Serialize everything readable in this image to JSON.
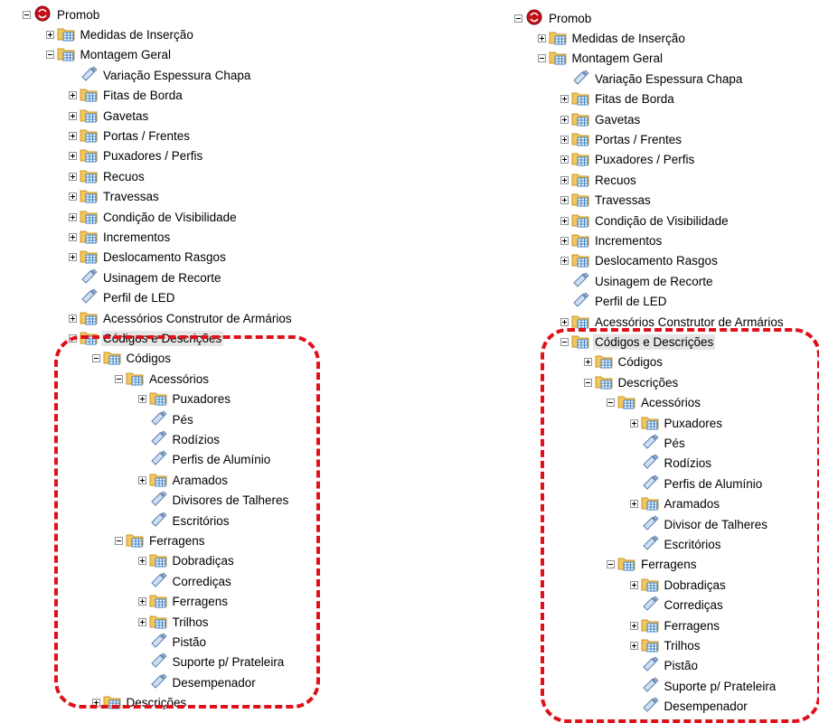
{
  "highlight_color": "#e0101a",
  "icons": {
    "root": "promob-logo-icon",
    "folder": "folder-table-icon",
    "leaf": "tag-pencil-icon"
  },
  "left_tree": {
    "items": [
      {
        "label": "Promob",
        "icon": "root",
        "exp": "minus",
        "depth": 0
      },
      {
        "label": "Medidas de Inserção",
        "icon": "folder",
        "exp": "plus",
        "depth": 1
      },
      {
        "label": "Montagem Geral",
        "icon": "folder",
        "exp": "minus",
        "depth": 1
      },
      {
        "label": "Variação Espessura Chapa",
        "icon": "leaf",
        "exp": "none",
        "depth": 2
      },
      {
        "label": "Fitas de Borda",
        "icon": "folder",
        "exp": "plus",
        "depth": 2
      },
      {
        "label": "Gavetas",
        "icon": "folder",
        "exp": "plus",
        "depth": 2
      },
      {
        "label": "Portas / Frentes",
        "icon": "folder",
        "exp": "plus",
        "depth": 2
      },
      {
        "label": "Puxadores / Perfis",
        "icon": "folder",
        "exp": "plus",
        "depth": 2
      },
      {
        "label": "Recuos",
        "icon": "folder",
        "exp": "plus",
        "depth": 2
      },
      {
        "label": "Travessas",
        "icon": "folder",
        "exp": "plus",
        "depth": 2
      },
      {
        "label": "Condição de Visibilidade",
        "icon": "folder",
        "exp": "plus",
        "depth": 2
      },
      {
        "label": "Incrementos",
        "icon": "folder",
        "exp": "plus",
        "depth": 2
      },
      {
        "label": "Deslocamento Rasgos",
        "icon": "folder",
        "exp": "plus",
        "depth": 2
      },
      {
        "label": "Usinagem de Recorte",
        "icon": "leaf",
        "exp": "none",
        "depth": 2
      },
      {
        "label": "Perfil de LED",
        "icon": "leaf",
        "exp": "none",
        "depth": 2
      },
      {
        "label": "Acessórios Construtor de Armários",
        "icon": "folder",
        "exp": "plus",
        "depth": 2
      },
      {
        "label": "Códigos e Descrições",
        "icon": "folder",
        "exp": "minus",
        "depth": 2,
        "selected": true
      },
      {
        "label": "Códigos",
        "icon": "folder",
        "exp": "minus",
        "depth": 3
      },
      {
        "label": "Acessórios",
        "icon": "folder",
        "exp": "minus",
        "depth": 4
      },
      {
        "label": "Puxadores",
        "icon": "folder",
        "exp": "plus",
        "depth": 5
      },
      {
        "label": "Pés",
        "icon": "leaf",
        "exp": "none",
        "depth": 5
      },
      {
        "label": "Rodízios",
        "icon": "leaf",
        "exp": "none",
        "depth": 5
      },
      {
        "label": "Perfis de Alumínio",
        "icon": "leaf",
        "exp": "none",
        "depth": 5
      },
      {
        "label": "Aramados",
        "icon": "folder",
        "exp": "plus",
        "depth": 5
      },
      {
        "label": "Divisores de Talheres",
        "icon": "leaf",
        "exp": "none",
        "depth": 5
      },
      {
        "label": "Escritórios",
        "icon": "leaf",
        "exp": "none",
        "depth": 5
      },
      {
        "label": "Ferragens",
        "icon": "folder",
        "exp": "minus",
        "depth": 4
      },
      {
        "label": "Dobradiças",
        "icon": "folder",
        "exp": "plus",
        "depth": 5
      },
      {
        "label": "Corrediças",
        "icon": "leaf",
        "exp": "none",
        "depth": 5
      },
      {
        "label": "Ferragens",
        "icon": "folder",
        "exp": "plus",
        "depth": 5
      },
      {
        "label": "Trilhos",
        "icon": "folder",
        "exp": "plus",
        "depth": 5
      },
      {
        "label": "Pistão",
        "icon": "leaf",
        "exp": "none",
        "depth": 5
      },
      {
        "label": "Suporte p/ Prateleira",
        "icon": "leaf",
        "exp": "none",
        "depth": 5
      },
      {
        "label": "Desempenador",
        "icon": "leaf",
        "exp": "none",
        "depth": 5
      },
      {
        "label": "Descrições",
        "icon": "folder",
        "exp": "plus",
        "depth": 3
      }
    ]
  },
  "right_tree": {
    "items": [
      {
        "label": "Promob",
        "icon": "root",
        "exp": "minus",
        "depth": 0
      },
      {
        "label": "Medidas de Inserção",
        "icon": "folder",
        "exp": "plus",
        "depth": 1
      },
      {
        "label": "Montagem Geral",
        "icon": "folder",
        "exp": "minus",
        "depth": 1
      },
      {
        "label": "Variação Espessura Chapa",
        "icon": "leaf",
        "exp": "none",
        "depth": 2
      },
      {
        "label": "Fitas de Borda",
        "icon": "folder",
        "exp": "plus",
        "depth": 2
      },
      {
        "label": "Gavetas",
        "icon": "folder",
        "exp": "plus",
        "depth": 2
      },
      {
        "label": "Portas / Frentes",
        "icon": "folder",
        "exp": "plus",
        "depth": 2
      },
      {
        "label": "Puxadores / Perfis",
        "icon": "folder",
        "exp": "plus",
        "depth": 2
      },
      {
        "label": "Recuos",
        "icon": "folder",
        "exp": "plus",
        "depth": 2
      },
      {
        "label": "Travessas",
        "icon": "folder",
        "exp": "plus",
        "depth": 2
      },
      {
        "label": "Condição de Visibilidade",
        "icon": "folder",
        "exp": "plus",
        "depth": 2
      },
      {
        "label": "Incrementos",
        "icon": "folder",
        "exp": "plus",
        "depth": 2
      },
      {
        "label": "Deslocamento Rasgos",
        "icon": "folder",
        "exp": "plus",
        "depth": 2
      },
      {
        "label": "Usinagem de Recorte",
        "icon": "leaf",
        "exp": "none",
        "depth": 2
      },
      {
        "label": "Perfil de LED",
        "icon": "leaf",
        "exp": "none",
        "depth": 2
      },
      {
        "label": "Acessórios Construtor de Armários",
        "icon": "folder",
        "exp": "plus",
        "depth": 2
      },
      {
        "label": "Códigos e Descrições",
        "icon": "folder",
        "exp": "minus",
        "depth": 2,
        "selected": true
      },
      {
        "label": "Códigos",
        "icon": "folder",
        "exp": "plus",
        "depth": 3
      },
      {
        "label": "Descrições",
        "icon": "folder",
        "exp": "minus",
        "depth": 3
      },
      {
        "label": "Acessórios",
        "icon": "folder",
        "exp": "minus",
        "depth": 4
      },
      {
        "label": "Puxadores",
        "icon": "folder",
        "exp": "plus",
        "depth": 5
      },
      {
        "label": "Pés",
        "icon": "leaf",
        "exp": "none",
        "depth": 5
      },
      {
        "label": "Rodízios",
        "icon": "leaf",
        "exp": "none",
        "depth": 5
      },
      {
        "label": "Perfis de Alumínio",
        "icon": "leaf",
        "exp": "none",
        "depth": 5
      },
      {
        "label": "Aramados",
        "icon": "folder",
        "exp": "plus",
        "depth": 5
      },
      {
        "label": "Divisor de Talheres",
        "icon": "leaf",
        "exp": "none",
        "depth": 5
      },
      {
        "label": "Escritórios",
        "icon": "leaf",
        "exp": "none",
        "depth": 5
      },
      {
        "label": "Ferragens",
        "icon": "folder",
        "exp": "minus",
        "depth": 4
      },
      {
        "label": "Dobradiças",
        "icon": "folder",
        "exp": "plus",
        "depth": 5
      },
      {
        "label": "Corrediças",
        "icon": "leaf",
        "exp": "none",
        "depth": 5
      },
      {
        "label": "Ferragens",
        "icon": "folder",
        "exp": "plus",
        "depth": 5
      },
      {
        "label": "Trilhos",
        "icon": "folder",
        "exp": "plus",
        "depth": 5
      },
      {
        "label": "Pistão",
        "icon": "leaf",
        "exp": "none",
        "depth": 5
      },
      {
        "label": "Suporte p/ Prateleira",
        "icon": "leaf",
        "exp": "none",
        "depth": 5
      },
      {
        "label": "Desempenador",
        "icon": "leaf",
        "exp": "none",
        "depth": 5
      }
    ]
  }
}
